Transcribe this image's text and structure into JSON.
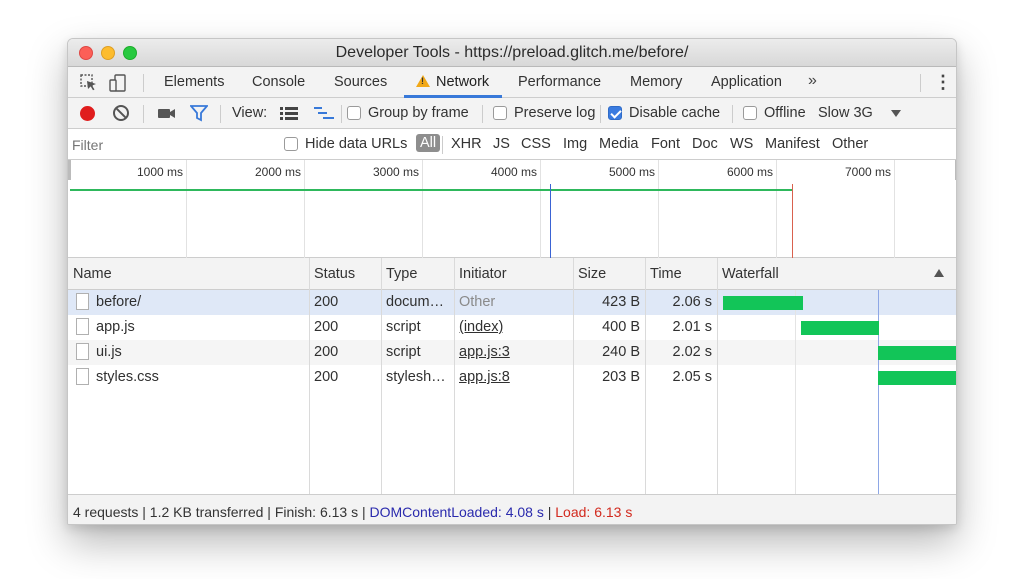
{
  "window": {
    "title": "Developer Tools - https://preload.glitch.me/before/"
  },
  "tabs": {
    "items": [
      "Elements",
      "Console",
      "Sources",
      "Network",
      "Performance",
      "Memory",
      "Application"
    ],
    "active": "Network",
    "more_label": "»",
    "menu_label": "⋮"
  },
  "toolbar": {
    "view_label": "View:",
    "group_by_frame_label": "Group by frame",
    "group_by_frame_checked": false,
    "preserve_log_label": "Preserve log",
    "preserve_log_checked": false,
    "disable_cache_label": "Disable cache",
    "disable_cache_checked": true,
    "offline_label": "Offline",
    "offline_checked": false,
    "throttling_value": "Slow 3G"
  },
  "filterbar": {
    "placeholder": "Filter",
    "hide_data_urls_label": "Hide data URLs",
    "hide_data_urls_checked": false,
    "types": [
      "All",
      "XHR",
      "JS",
      "CSS",
      "Img",
      "Media",
      "Font",
      "Doc",
      "WS",
      "Manifest",
      "Other"
    ],
    "active_type": "All"
  },
  "overview": {
    "ticks": [
      "1000 ms",
      "2000 ms",
      "3000 ms",
      "4000 ms",
      "5000 ms",
      "6000 ms",
      "7000 ms"
    ]
  },
  "table": {
    "columns": [
      "Name",
      "Status",
      "Type",
      "Initiator",
      "Size",
      "Time",
      "Waterfall"
    ],
    "rows": [
      {
        "name": "before/",
        "status": "200",
        "type": "docum…",
        "initiator": "Other",
        "size": "423 B",
        "time": "2.06 s"
      },
      {
        "name": "app.js",
        "status": "200",
        "type": "script",
        "initiator": "(index)",
        "size": "400 B",
        "time": "2.01 s"
      },
      {
        "name": "ui.js",
        "status": "200",
        "type": "script",
        "initiator": "app.js:3",
        "size": "240 B",
        "time": "2.02 s"
      },
      {
        "name": "styles.css",
        "status": "200",
        "type": "stylesh…",
        "initiator": "app.js:8",
        "size": "203 B",
        "time": "2.05 s"
      }
    ]
  },
  "status": {
    "summary": "4 requests | 1.2 KB transferred | Finish: 6.13 s | ",
    "dcl": "DOMContentLoaded: 4.08 s",
    "sep": " | ",
    "load": "Load: 6.13 s"
  },
  "colors": {
    "accent": "#3879d9",
    "waterfall_bar": "#12c558",
    "dcl": "#2a2aad",
    "load": "#d22a1e"
  },
  "icons": [
    "inspect-icon",
    "device-icon",
    "record-icon",
    "clear-icon",
    "camera-icon",
    "filter-icon",
    "large-rows-icon",
    "waterfall-view-icon",
    "warning-icon",
    "file-icon",
    "sort-asc-icon"
  ]
}
